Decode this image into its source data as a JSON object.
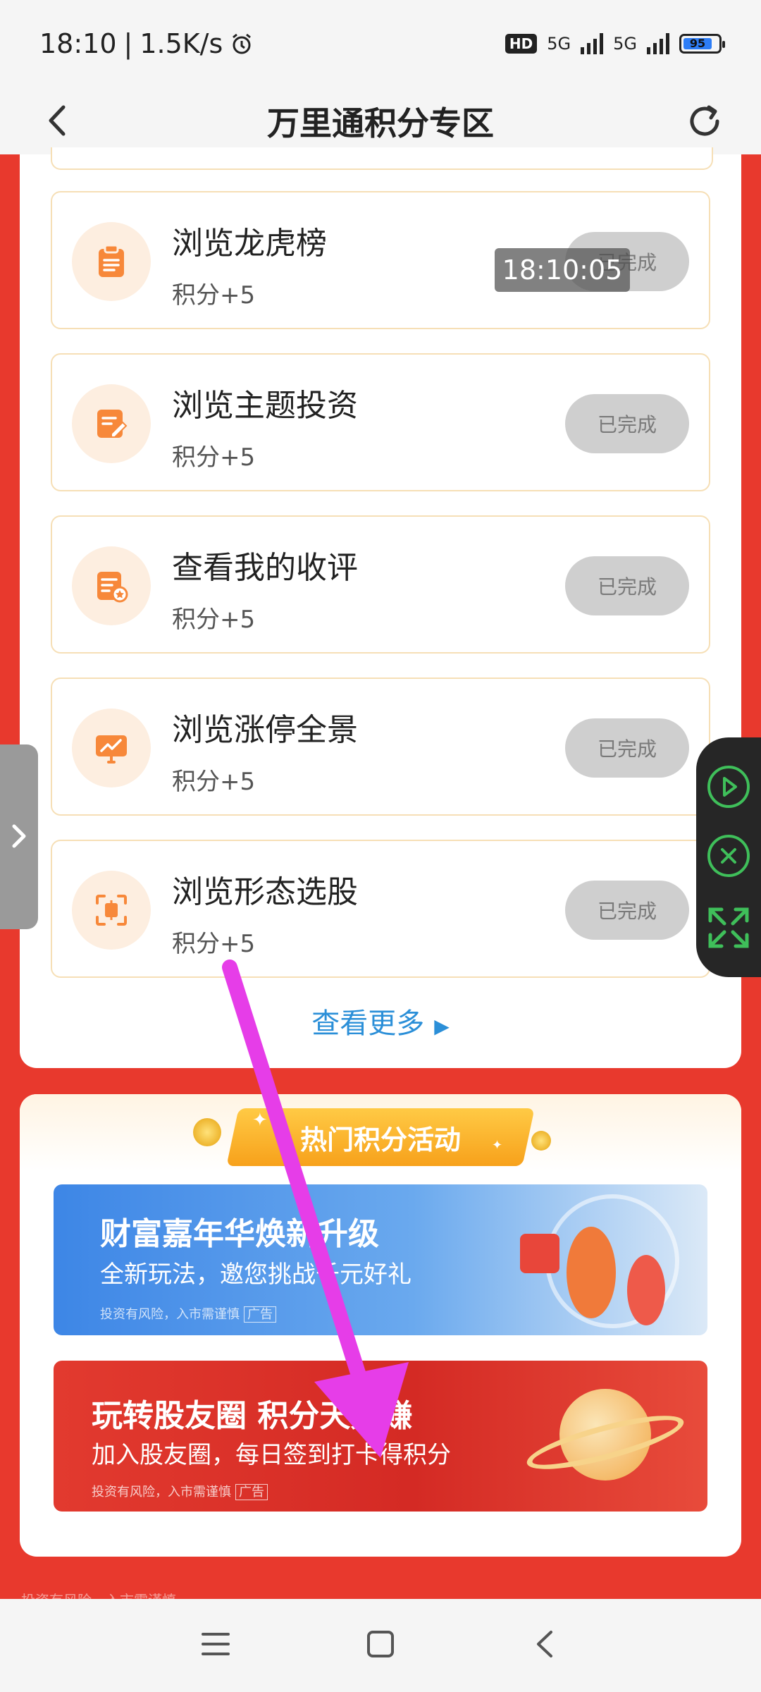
{
  "status_bar": {
    "time": "18:10",
    "net_speed": "1.5K/s",
    "hd_badge": "HD",
    "signal1": "5G",
    "signal2": "5G",
    "battery": "95"
  },
  "header": {
    "title": "万里通积分专区"
  },
  "tasks": [
    {
      "name": "浏览龙虎榜",
      "points": "积分+5",
      "status": "已完成",
      "icon": "clipboard-icon"
    },
    {
      "name": "浏览主题投资",
      "points": "积分+5",
      "status": "已完成",
      "icon": "edit-doc-icon"
    },
    {
      "name": "查看我的收评",
      "points": "积分+5",
      "status": "已完成",
      "icon": "review-doc-icon"
    },
    {
      "name": "浏览涨停全景",
      "points": "积分+5",
      "status": "已完成",
      "icon": "chart-monitor-icon"
    },
    {
      "name": "浏览形态选股",
      "points": "积分+5",
      "status": "已完成",
      "icon": "focus-frame-icon"
    }
  ],
  "see_more": "查看更多",
  "activities": {
    "title": "热门积分活动",
    "banners": [
      {
        "title": "财富嘉年华焕新升级",
        "subtitle": "全新玩法，邀您挑战千元好礼",
        "fine": "投资有风险，入市需谨慎",
        "tag": "广告"
      },
      {
        "title": "玩转股友圈 积分天天赚",
        "subtitle": "加入股友圈，每日签到打卡得积分",
        "fine": "投资有风险，入市需谨慎",
        "tag": "广告"
      }
    ]
  },
  "bottom_fine": "投资有风险，入市需谨慎",
  "overlay": {
    "timestamp": "18:10:05"
  },
  "colors": {
    "brand_red": "#e8392d",
    "link_blue": "#2b8fd8",
    "done_gray": "#cfcfcf",
    "accent_orange": "#f7a11b"
  }
}
